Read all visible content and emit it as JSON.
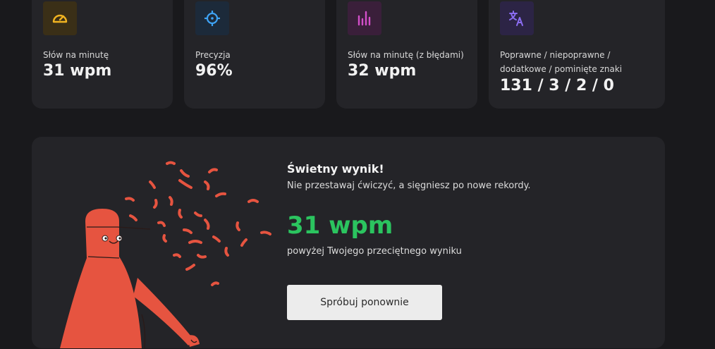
{
  "stats": [
    {
      "icon": "speedometer-icon",
      "color": "#f0b321",
      "bg": "#3a2f17",
      "label": "Słów na minutę",
      "value": "31 wpm"
    },
    {
      "icon": "crosshair-icon",
      "color": "#3ea3f5",
      "bg": "#1c2a3a",
      "label": "Precyzja",
      "value": "96%"
    },
    {
      "icon": "bar-chart-icon",
      "color": "#d34fc9",
      "bg": "#3a1f3a",
      "label": "Słów na minutę (z błędami)",
      "value": "32 wpm"
    },
    {
      "icon": "translate-icon",
      "color": "#8a6cf0",
      "bg": "#2c2445",
      "label": "Poprawne / niepoprawne / dodatkowe / pominięte znaki",
      "value": "131 / 3 / 2 / 0"
    }
  ],
  "result": {
    "title": "Świetny wynik!",
    "subtitle": "Nie przestawaj ćwiczyć, a sięgniesz po nowe rekordy.",
    "wpm": "31 wpm",
    "note": "powyżej Twojego przeciętnego wyniku",
    "button_label": "Spróbuj ponownie",
    "accent": "#2bc45f",
    "figure_color": "#e65440"
  }
}
